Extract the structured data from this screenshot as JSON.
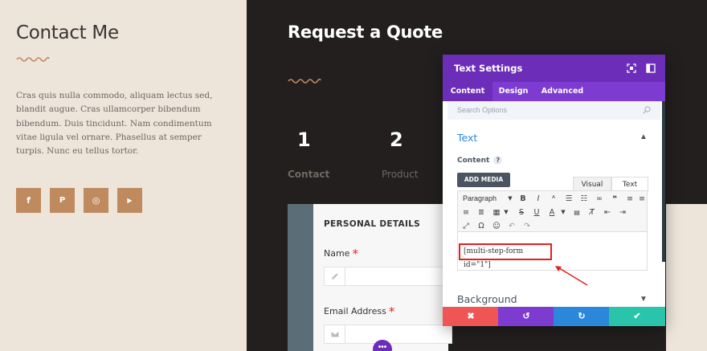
{
  "left": {
    "title": "Contact Me",
    "paragraph": "Cras quis nulla commodo, aliquam lectus sed, blandit augue. Cras ullamcorper bibendum bibendum. Duis tincidunt. Nam condimentum vitae ligula vel ornare. Phasellus at semper turpis. Nunc eu tellus tortor.",
    "social": [
      {
        "icon": "facebook-icon",
        "glyph": "f"
      },
      {
        "icon": "pinterest-icon",
        "glyph": "P"
      },
      {
        "icon": "instagram-icon",
        "glyph": "◎"
      },
      {
        "icon": "youtube-icon",
        "glyph": "▶"
      }
    ],
    "accent_color": "#c08a5f"
  },
  "right": {
    "title": "Request a Quote",
    "steps": [
      {
        "number": "1",
        "label": "Contact"
      },
      {
        "number": "2",
        "label": "Product"
      }
    ],
    "form": {
      "section_title": "PERSONAL DETAILS",
      "fields": [
        {
          "label": "Name",
          "required_mark": "*",
          "icon": "pencil-icon"
        },
        {
          "label": "Email Address",
          "required_mark": "*",
          "icon": "envelope-icon"
        }
      ]
    }
  },
  "modal": {
    "title": "Text Settings",
    "tabs": [
      "Content",
      "Design",
      "Advanced"
    ],
    "active_tab": "Content",
    "search_placeholder": "Search Options",
    "section_title": "Text",
    "content_label": "Content",
    "help_glyph": "?",
    "add_media_label": "ADD MEDIA",
    "editor_tabs": [
      "Visual",
      "Text"
    ],
    "paragraph_select": "Paragraph",
    "shortcode": "[multi-step-form id=\"1\"]",
    "background_section": "Background",
    "footer": {
      "cancel_glyph": "✖",
      "undo_glyph": "↺",
      "redo_glyph": "↻",
      "save_glyph": "✔"
    },
    "colors": {
      "header": "#6c2eb9",
      "tabs": "#7d3bd1",
      "cancel": "#ef5555",
      "undo": "#7e3bd0",
      "redo": "#2b87da",
      "save": "#29c4a9"
    }
  }
}
